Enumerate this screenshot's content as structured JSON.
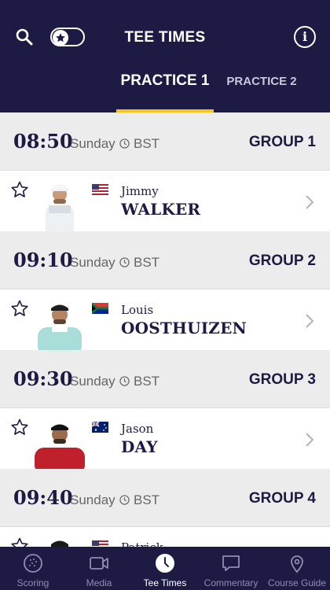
{
  "header": {
    "title": "TEE TIMES",
    "search_icon": "search-icon",
    "favourites_toggle_icon": "star-toggle-icon",
    "info_icon": "info-icon",
    "info_glyph": "i"
  },
  "tabs": [
    {
      "label": "PRACTICE 1",
      "active": true
    },
    {
      "label": "PRACTICE 2",
      "active": false
    }
  ],
  "accent_color": "#f5c518",
  "brand_color": "#1d1b44",
  "groups": [
    {
      "time": "08:50",
      "day": "Sunday",
      "tz": "BST",
      "group": "GROUP 1",
      "player": {
        "first": "Jimmy",
        "last": "WALKER",
        "flag": "US"
      }
    },
    {
      "time": "09:10",
      "day": "Sunday",
      "tz": "BST",
      "group": "GROUP 2",
      "player": {
        "first": "Louis",
        "last": "OOSTHUIZEN",
        "flag": "ZA"
      }
    },
    {
      "time": "09:30",
      "day": "Sunday",
      "tz": "BST",
      "group": "GROUP 3",
      "player": {
        "first": "Jason",
        "last": "DAY",
        "flag": "AU"
      }
    },
    {
      "time": "09:40",
      "day": "Sunday",
      "tz": "BST",
      "group": "GROUP 4",
      "player": {
        "first": "Patrick",
        "last": "",
        "flag": "US"
      }
    }
  ],
  "tabbar": [
    {
      "label": "Scoring",
      "icon": "golf-ball-icon",
      "active": false
    },
    {
      "label": "Media",
      "icon": "video-camera-icon",
      "active": false
    },
    {
      "label": "Tee Times",
      "icon": "clock-icon",
      "active": true
    },
    {
      "label": "Commentary",
      "icon": "speech-bubble-icon",
      "active": false
    },
    {
      "label": "Course Guide",
      "icon": "map-pin-icon",
      "active": false
    }
  ]
}
